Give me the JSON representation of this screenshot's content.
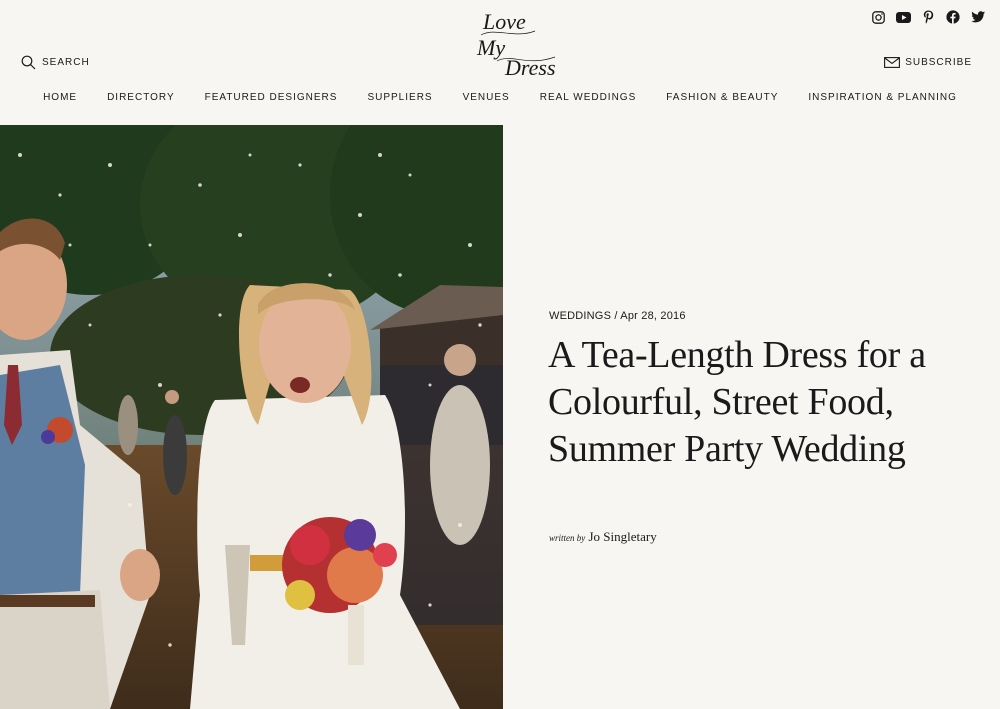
{
  "header": {
    "search_label": "SEARCH",
    "subscribe_label": "SUBSCRIBE",
    "logo_text": [
      "Love",
      "My",
      "Dress"
    ],
    "social_icons": [
      "instagram-icon",
      "youtube-icon",
      "pinterest-icon",
      "facebook-icon",
      "twitter-icon"
    ]
  },
  "nav": {
    "items": [
      "HOME",
      "DIRECTORY",
      "FEATURED DESIGNERS",
      "SUPPLIERS",
      "VENUES",
      "REAL WEDDINGS",
      "FASHION & BEAUTY",
      "INSPIRATION & PLANNING"
    ]
  },
  "article": {
    "category": "WEDDINGS",
    "separator": " / ",
    "date": "Apr 28, 2016",
    "title": "A Tea-Length Dress for a Colourful, Street Food, Summer Party Wedding",
    "byline_prefix": "written by",
    "author": "Jo Singletary"
  },
  "colors": {
    "background": "#f8f6f3",
    "text": "#1a1a1a"
  }
}
